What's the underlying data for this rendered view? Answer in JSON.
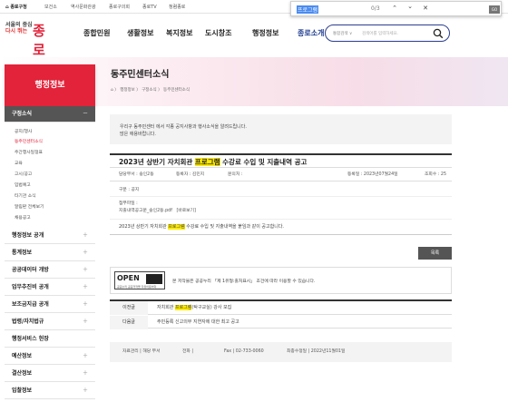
{
  "topbar": {
    "home": "종로구청",
    "links": [
      "보건소",
      "역사문화관광",
      "종로구의회",
      "종로TV",
      "청렴종로"
    ]
  },
  "findbar": {
    "query": "프로그램",
    "count": "0/3",
    "go": "GO"
  },
  "logo": {
    "line1": "서울의 중심",
    "line2": "다시 뛰는",
    "main": "종로"
  },
  "gnb": [
    "종합민원",
    "생활정보",
    "복지정보",
    "도시창조",
    "행정정보",
    "종로소개"
  ],
  "search": {
    "scope": "통합검색 ∨",
    "placeholder": "검색어를 입력하세요."
  },
  "hero": {
    "title": "동주민센터소식",
    "breadcrumb": "⌂ 〉 행정정보 〉 구정소식 〉 동주민센터소식"
  },
  "sidebar": {
    "header": "행정정보",
    "categories": [
      {
        "label": "구정소식",
        "toggle": "－"
      },
      {
        "label": "행정정보 공개",
        "toggle": "＋"
      },
      {
        "label": "통계정보",
        "toggle": "＋"
      },
      {
        "label": "공공데이터 개방",
        "toggle": "＋"
      },
      {
        "label": "업무추진비 공개",
        "toggle": "＋"
      },
      {
        "label": "보조금지급 공개",
        "toggle": "＋"
      },
      {
        "label": "법령/자치법규",
        "toggle": "＋"
      },
      {
        "label": "행정서비스 헌장",
        "toggle": ""
      },
      {
        "label": "예산정보",
        "toggle": "＋"
      },
      {
        "label": "결산정보",
        "toggle": "＋"
      },
      {
        "label": "입찰정보",
        "toggle": "＋"
      }
    ],
    "subitems": [
      "공지/행사",
      "동주민센터소식",
      "주간행사일정표",
      "교육",
      "고시/공고",
      "입법예고",
      "타기관 소식",
      "알림판 전체보기",
      "채용공고"
    ]
  },
  "intro": {
    "line1": "우리구 동주민센터 에서 각종 공지사항과 행사소식을 알려드립니다.",
    "line2": "많은 애용바랍니다."
  },
  "post": {
    "title_pre": "2023년 상반기 자치회관 ",
    "title_hl": "프로그램",
    "title_post": " 수강료 수입 및 지출내역 공고",
    "dept": "담당부서 : 숭인2동",
    "author": "등록자 : 김민지",
    "inquiry": "문의처 :",
    "date": "등록일 : 2023년07월24일",
    "views": "조회수 : 25",
    "type": "구분 : 공지",
    "attach_label": "첨부파일 :",
    "attach_file": "지출내역공고문_숭인2동.pdf",
    "attach_view": "[바로보기]",
    "body_pre": "2023년 상반기 자치회관 ",
    "body_hl": "프로그램",
    "body_post": " 수강료 수입 및 지출내역을 붙임과 같이 공고합니다."
  },
  "list_button": "목록",
  "license": {
    "open": "OPEN",
    "kogl": "공공누리 공공저작물 자유이용허락",
    "text": "본 저작물은 공공누리 「제 1유형:출처표시」 조건에 따라 이용할 수 있습니다."
  },
  "nav": {
    "prev_label": "이전글",
    "prev_pre": "자치회관 ",
    "prev_hl": "프로그램",
    "prev_post": "(탁구교실) 강사 모집",
    "next_label": "다음글",
    "next_text": "주민등록 신고의무 지연자에 대한 최고 공고"
  },
  "footer": {
    "manager": "자료관리 | 해당 부서",
    "phone": "전화 |",
    "fax": "Fax | 02-733-0060",
    "updated": "최종수정일 | 2022년11월01일"
  },
  "colors": {
    "brand_red": "#e2233a",
    "navy": "#1d3a8f",
    "highlight": "#ffeb00"
  }
}
